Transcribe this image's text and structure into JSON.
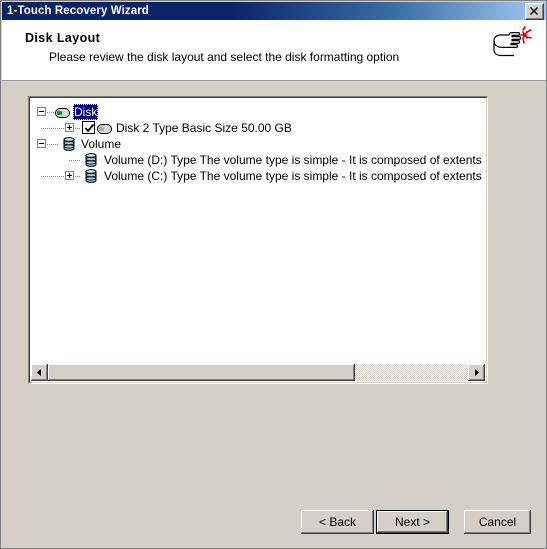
{
  "window": {
    "title": "1-Touch Recovery Wizard",
    "close_icon": "close-x-icon"
  },
  "header": {
    "title": "Disk Layout",
    "subtitle": "Please review the disk layout and select the disk formatting option",
    "icon": "pointing-hand-click-icon"
  },
  "tree": {
    "rows": [
      {
        "label": "Disk",
        "icon": "disk-drive-icon",
        "expander": "minus",
        "selected": true,
        "checkbox": null,
        "level": 0
      },
      {
        "label": "Disk 2 Type Basic Size 50.00 GB",
        "icon": "disk-drive-icon",
        "expander": "plus",
        "selected": false,
        "checkbox": "checked",
        "level": 1
      },
      {
        "label": "Volume",
        "icon": "volume-cylinder-icon",
        "expander": "minus",
        "selected": false,
        "checkbox": null,
        "level": 0
      },
      {
        "label": "Volume (D:) Type The volume type is simple - It is composed of extents from exactly",
        "icon": "volume-cylinder-icon",
        "expander": "none",
        "selected": false,
        "checkbox": null,
        "level": 1
      },
      {
        "label": "Volume (C:) Type The volume type is simple - It is composed of extents from exactly",
        "icon": "volume-cylinder-icon",
        "expander": "plus",
        "selected": false,
        "checkbox": null,
        "level": 1
      }
    ],
    "hscrollbar": {
      "left_arrow_icon": "arrow-left-icon",
      "right_arrow_icon": "arrow-right-icon",
      "thumb_percent": 73
    }
  },
  "buttons": {
    "back": "< Back",
    "next": "Next >",
    "cancel": "Cancel"
  },
  "colors": {
    "titlebar_start": "#0a246a",
    "titlebar_end": "#a6caf0",
    "dialog_face": "#d4d0c8",
    "selection": "#000080",
    "header_band": "#ffffff"
  }
}
